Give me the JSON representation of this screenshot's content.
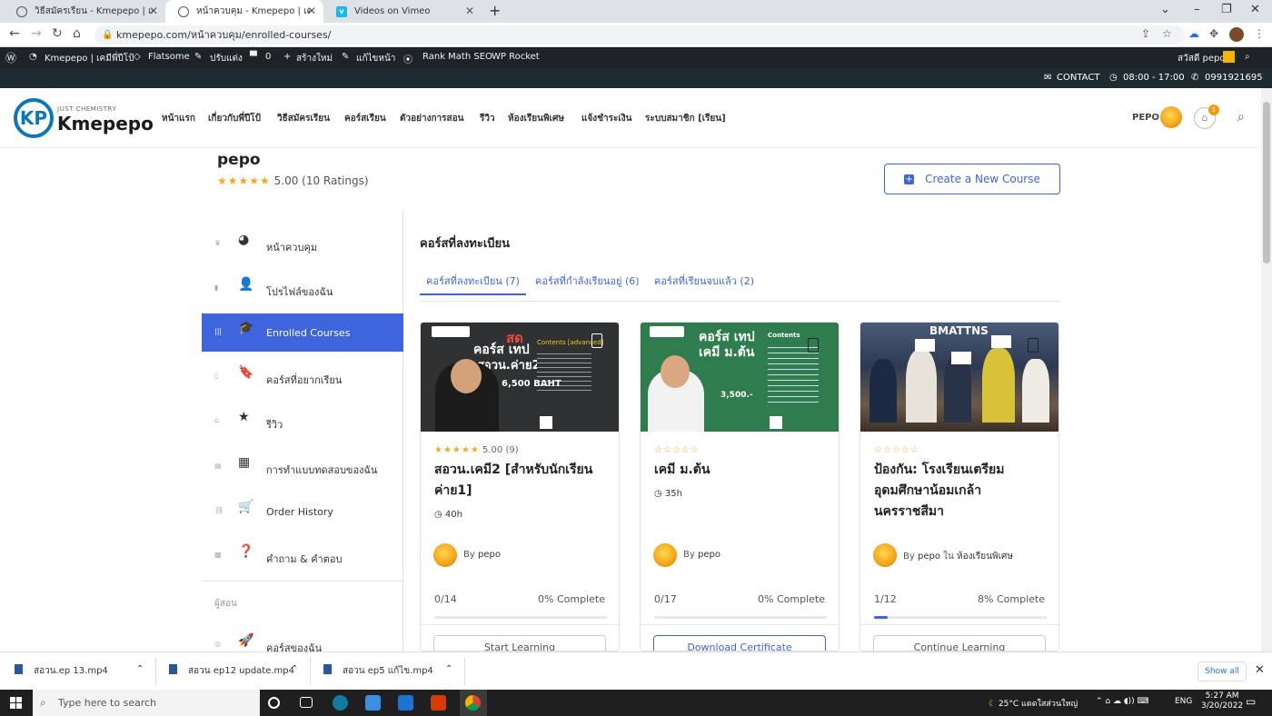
{
  "browser": {
    "tabs": [
      {
        "title": "วิธีสมัครเรียน - Kmepepo | เคมีพี่ปีโป้",
        "icon": "globe-icon"
      },
      {
        "title": "หน้าควบคุม - Kmepepo | เคมีพี่ปีโป้",
        "icon": "globe-icon"
      },
      {
        "title": "Videos on Vimeo",
        "icon": "vimeo-icon"
      }
    ],
    "url": "kmepepo.com/หน้าควบคุม/enrolled-courses/"
  },
  "wp_admin": {
    "site": "Kmepepo | เคมีพี่ปีโป้",
    "theme": "Flatsome",
    "customize": "ปรับแต่ง",
    "comments": "0",
    "new": "สร้างใหม่",
    "edit": "แก้ไขหน้า",
    "seo": "Rank Math SEO",
    "rocket": "WP Rocket",
    "greeting": "สวัสดี pepo"
  },
  "topbar": {
    "contact": "CONTACT",
    "hours": "08:00 - 17:00",
    "phone": "0991921695"
  },
  "header": {
    "logo_tag": "JUST CHEMISTRY",
    "logo_name": "Kmepepo",
    "menu": [
      "หน้าแรก",
      "เกี่ยวกับพี่ปีโป้",
      "วิธีสมัครเรียน",
      "คอร์สเรียน",
      "ตัวอย่างการสอน",
      "รีวิว",
      "ห้องเรียนพิเศษ",
      "แจ้งชำระเงิน",
      "ระบบสมาชิก [เรียน]"
    ],
    "user": "PEPO",
    "cart_count": "1"
  },
  "profile": {
    "name": "pepo",
    "stars": "★★★★★",
    "rating": "5.00 (10 Ratings)",
    "create_button": "Create a New Course"
  },
  "sidebar": {
    "items": [
      {
        "label": "หน้าควบคุม",
        "icon": "dashboard-icon"
      },
      {
        "label": "โปรไฟล์ของฉัน",
        "icon": "user-icon"
      },
      {
        "label": "Enrolled Courses",
        "icon": "graduation-cap-icon"
      },
      {
        "label": "คอร์สที่อยากเรียน",
        "icon": "bookmark-icon"
      },
      {
        "label": "รีวิว",
        "icon": "star-icon"
      },
      {
        "label": "การทำแบบทดสอบของฉัน",
        "icon": "quiz-icon"
      },
      {
        "label": "Order History",
        "icon": "cart-icon"
      },
      {
        "label": "คำถาม & คำตอบ",
        "icon": "question-icon"
      },
      {
        "label": "คอร์สของฉัน",
        "icon": "rocket-icon"
      }
    ],
    "section_instructor": "ผู้สอน"
  },
  "main": {
    "title": "คอร์สที่ลงทะเบียน",
    "tabs": [
      "คอร์สที่ลงทะเบียน (7)",
      "คอร์สที่กำลังเรียนอยู่ (6)",
      "คอร์สที่เรียนจบแล้ว (2)"
    ],
    "courses": [
      {
        "stars": "★★★★★",
        "rating": "5.00 (9)",
        "title": "สอวน.เคมี2 [สำหรับนักเรียนค่าย1]",
        "duration": "40h",
        "by": "By",
        "author": "pepo",
        "category": "",
        "progress": "0/14",
        "complete": "0% Complete",
        "complete_fraction": 0,
        "button": "Start Learning",
        "thumb": {
          "line1": "สด",
          "line2": "คอร์ส เทป",
          "line3": "สอวน.ค่าย2",
          "contents": "Contents [advanced]",
          "price": "6,500 BAHT"
        }
      },
      {
        "stars": "☆☆☆☆☆",
        "rating": "",
        "title": "เคมี ม.ต้น",
        "duration": "35h",
        "by": "By",
        "author": "pepo",
        "category": "",
        "progress": "0/17",
        "complete": "0% Complete",
        "complete_fraction": 0,
        "button": "Download Certificate",
        "thumb": {
          "line1": "คอร์ส เทป",
          "line2": "เคมี ม.ต้น",
          "contents": "Contents",
          "price": "3,500.-"
        }
      },
      {
        "stars": "☆☆☆☆☆",
        "rating": "",
        "title": "ป้องกัน: โรงเรียนเตรียมอุดมศึกษาน้อมเกล้า นครราชสีมา",
        "duration": "",
        "by": "By",
        "author": "pepo",
        "in": "ใน",
        "category": "ห้องเรียนพิเศษ",
        "progress": "1/12",
        "complete": "8% Complete",
        "complete_fraction": 0.08,
        "button": "Continue Learning",
        "thumb": {
          "line1": "BMATTNS"
        }
      }
    ]
  },
  "downloads": {
    "files": [
      "สอวน.ep 13.mp4",
      "สอวน ep12 update.mp4",
      "สอวน ep5 แก้ไข.mp4"
    ],
    "show_all": "Show all"
  },
  "taskbar": {
    "search_placeholder": "Type here to search",
    "weather": "25°C แดดใสส่วนใหญ่",
    "lang": "ENG",
    "time": "5:27 AM",
    "date": "3/20/2022"
  },
  "colors": {
    "accent": "#3e64de",
    "star": "#f5a623",
    "wp_bar": "#1d2327",
    "contact_bar": "#1f2b33"
  }
}
